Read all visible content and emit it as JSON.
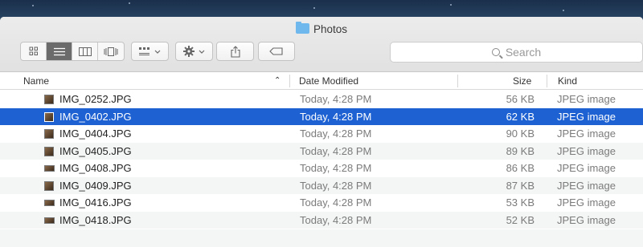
{
  "window": {
    "title": "Photos"
  },
  "toolbar": {
    "view_modes": [
      "icon-view",
      "list-view",
      "column-view",
      "cover-flow-view"
    ],
    "active_view": "list-view",
    "search_placeholder": "Search"
  },
  "columns": {
    "name": "Name",
    "date": "Date Modified",
    "size": "Size",
    "kind": "Kind"
  },
  "files": [
    {
      "name": "IMG_0252.JPG",
      "date": "Today, 4:28 PM",
      "size": "56 KB",
      "kind": "JPEG image",
      "orientation": "portrait",
      "selected": false
    },
    {
      "name": "IMG_0402.JPG",
      "date": "Today, 4:28 PM",
      "size": "62 KB",
      "kind": "JPEG image",
      "orientation": "portrait",
      "selected": true
    },
    {
      "name": "IMG_0404.JPG",
      "date": "Today, 4:28 PM",
      "size": "90 KB",
      "kind": "JPEG image",
      "orientation": "portrait",
      "selected": false
    },
    {
      "name": "IMG_0405.JPG",
      "date": "Today, 4:28 PM",
      "size": "89 KB",
      "kind": "JPEG image",
      "orientation": "portrait",
      "selected": false
    },
    {
      "name": "IMG_0408.JPG",
      "date": "Today, 4:28 PM",
      "size": "86 KB",
      "kind": "JPEG image",
      "orientation": "landscape",
      "selected": false
    },
    {
      "name": "IMG_0409.JPG",
      "date": "Today, 4:28 PM",
      "size": "87 KB",
      "kind": "JPEG image",
      "orientation": "portrait",
      "selected": false
    },
    {
      "name": "IMG_0416.JPG",
      "date": "Today, 4:28 PM",
      "size": "53 KB",
      "kind": "JPEG image",
      "orientation": "landscape",
      "selected": false
    },
    {
      "name": "IMG_0418.JPG",
      "date": "Today, 4:28 PM",
      "size": "52 KB",
      "kind": "JPEG image",
      "orientation": "landscape",
      "selected": false
    }
  ],
  "colors": {
    "selection": "#1d61d2",
    "folder": "#6fb8ee",
    "stripe": "#f4f5f5"
  }
}
